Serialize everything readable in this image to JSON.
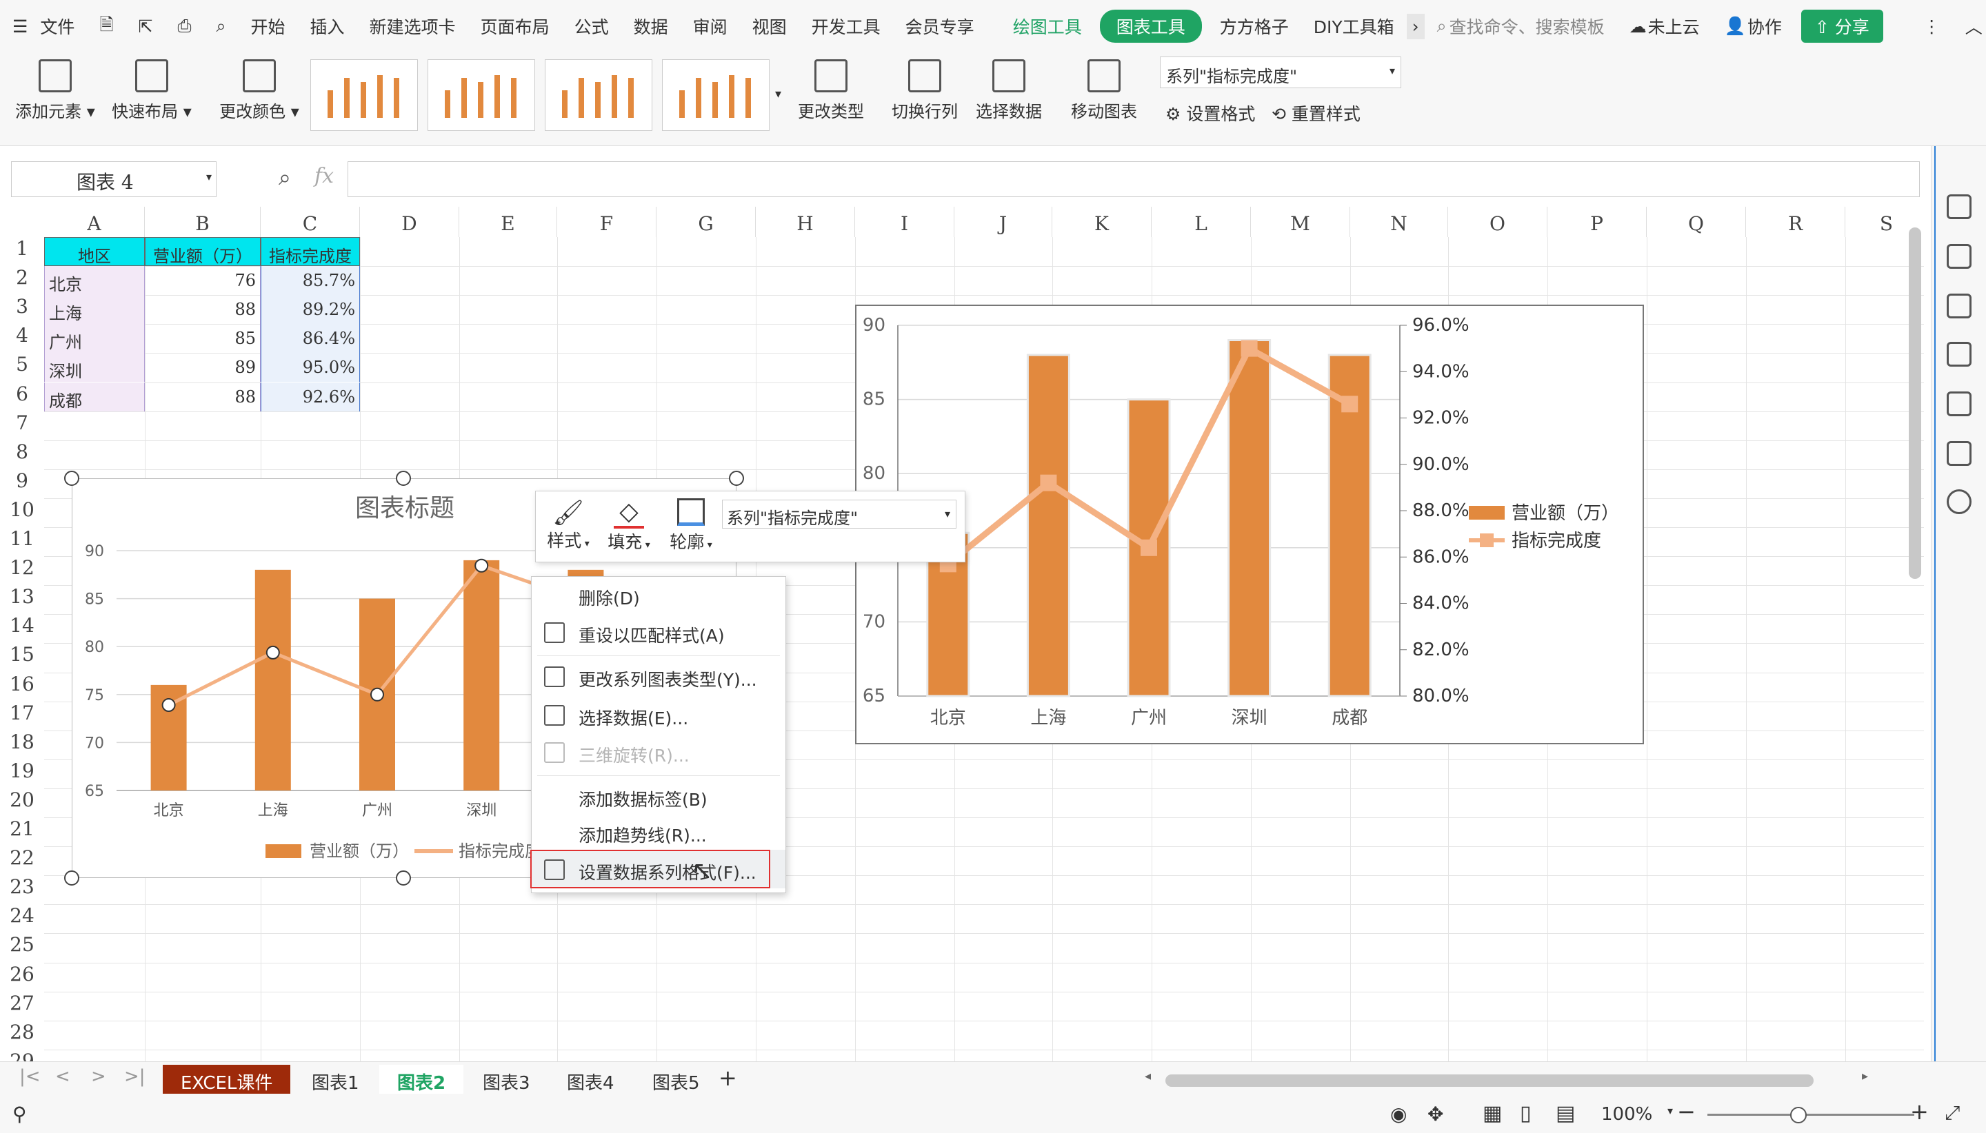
{
  "menubar": {
    "file": "文件",
    "tabs": [
      "开始",
      "插入",
      "新建选项卡",
      "页面布局",
      "公式",
      "数据",
      "审阅",
      "视图",
      "开发工具",
      "会员专享"
    ],
    "draw_tools": "绘图工具",
    "chart_tools": "图表工具",
    "ffgz": "方方格子",
    "diy": "DIY工具箱",
    "search_placeholder": "查找命令、搜索模板",
    "cloud": "未上云",
    "collab": "协作",
    "share": "分享"
  },
  "ribbon": {
    "add_element": "添加元素",
    "quick_layout": "快速布局",
    "change_color": "更改颜色",
    "change_type": "更改类型",
    "switch_rowcol": "切换行列",
    "select_data": "选择数据",
    "move_chart": "移动图表",
    "series_select": "系列\"指标完成度\"",
    "set_format": "设置格式",
    "reset_style": "重置样式"
  },
  "formula": {
    "namebox": "图表 4",
    "fx": "fx"
  },
  "columns": [
    "A",
    "B",
    "C",
    "D",
    "E",
    "F",
    "G",
    "H",
    "I",
    "J",
    "K",
    "L",
    "M",
    "N",
    "O",
    "P",
    "Q",
    "R",
    "S"
  ],
  "rows": [
    "1",
    "2",
    "3",
    "4",
    "5",
    "6",
    "7",
    "8",
    "9",
    "10",
    "11",
    "12",
    "13",
    "14",
    "15",
    "16",
    "17",
    "18",
    "19",
    "20",
    "21",
    "22",
    "23",
    "24",
    "25",
    "26",
    "27",
    "28",
    "29"
  ],
  "table": {
    "headers": [
      "地区",
      "营业额（万）",
      "指标完成度"
    ],
    "rows": [
      [
        "北京",
        "76",
        "85.7%"
      ],
      [
        "上海",
        "88",
        "89.2%"
      ],
      [
        "广州",
        "85",
        "86.4%"
      ],
      [
        "深圳",
        "89",
        "95.0%"
      ],
      [
        "成都",
        "88",
        "92.6%"
      ]
    ]
  },
  "minitoolbar": {
    "style": "样式",
    "fill": "填充",
    "outline": "轮廓",
    "series": "系列\"指标完成度\""
  },
  "context_menu": [
    {
      "label": "删除(D)",
      "disabled": false
    },
    {
      "label": "重设以匹配样式(A)",
      "disabled": false
    },
    {
      "label": "更改系列图表类型(Y)...",
      "disabled": false
    },
    {
      "label": "选择数据(E)...",
      "disabled": false
    },
    {
      "label": "三维旋转(R)...",
      "disabled": true
    },
    {
      "label": "添加数据标签(B)",
      "disabled": false
    },
    {
      "label": "添加趋势线(R)...",
      "disabled": false
    },
    {
      "label": "设置数据系列格式(F)...",
      "disabled": false,
      "highlighted": true
    }
  ],
  "sheets": {
    "tabs": [
      "EXCEL课件",
      "图表1",
      "图表2",
      "图表3",
      "图表4",
      "图表5"
    ],
    "active": "图表2"
  },
  "status": {
    "zoom": "100%"
  },
  "colors": {
    "bar": "#e2893e",
    "line": "#f4b183",
    "header_fill": "#00e5ee",
    "green": "#1fa463",
    "highlight_box": "#e03030"
  },
  "chart_data": [
    {
      "type": "bar",
      "title": "图表标题",
      "categories": [
        "北京",
        "上海",
        "广州",
        "深圳",
        "成都"
      ],
      "series": [
        {
          "name": "营业额（万）",
          "type": "bar",
          "axis": "left",
          "values": [
            76,
            88,
            85,
            89,
            88
          ]
        },
        {
          "name": "指标完成度",
          "type": "line",
          "axis": "right",
          "values": [
            0.857,
            0.892,
            0.864,
            0.95,
            0.926
          ]
        }
      ],
      "ylim": [
        65,
        90
      ],
      "y2lim": [
        0.8,
        0.96
      ],
      "yticks": [
        "90",
        "85",
        "80",
        "75",
        "70",
        "65"
      ],
      "legend": "bottom",
      "grid": true
    },
    {
      "type": "bar",
      "title": "",
      "categories": [
        "北京",
        "上海",
        "广州",
        "深圳",
        "成都"
      ],
      "series": [
        {
          "name": "营业额（万）",
          "type": "bar",
          "axis": "left",
          "values": [
            76,
            88,
            85,
            89,
            88
          ]
        },
        {
          "name": "指标完成度",
          "type": "line",
          "axis": "right",
          "values": [
            0.857,
            0.892,
            0.864,
            0.95,
            0.926
          ]
        }
      ],
      "ylim": [
        65,
        90
      ],
      "y2lim": [
        0.8,
        0.96
      ],
      "yticks": [
        "90",
        "85",
        "80",
        "75",
        "70",
        "65"
      ],
      "y2ticks": [
        "96.0%",
        "94.0%",
        "92.0%",
        "90.0%",
        "88.0%",
        "86.0%",
        "84.0%",
        "82.0%",
        "80.0%"
      ],
      "legend": "right",
      "grid": true
    }
  ]
}
